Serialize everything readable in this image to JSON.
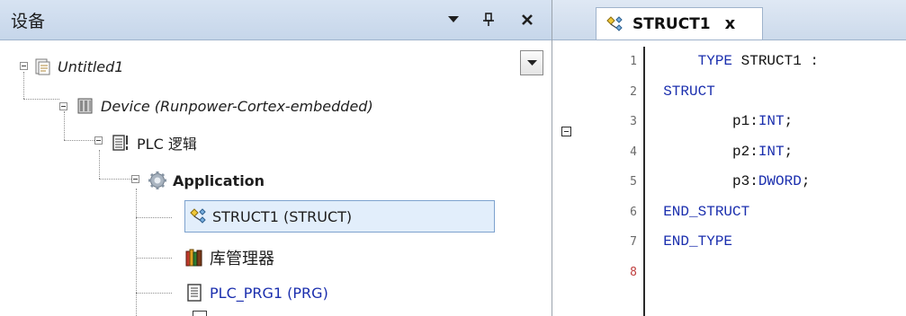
{
  "devices_panel": {
    "title": "设备",
    "pin_glyph": "ᵠ",
    "close_glyph": "✕"
  },
  "tree": {
    "nodes": [
      {
        "label": "Untitled1",
        "icon": "project-icon"
      },
      {
        "label": "Device (Runpower-Cortex-embedded)",
        "icon": "device-icon"
      },
      {
        "label": "PLC 逻辑",
        "icon": "plc-logic-icon"
      },
      {
        "label": "Application",
        "icon": "application-gear-icon"
      },
      {
        "label": "STRUCT1 (STRUCT)",
        "icon": "struct-icon",
        "selected": true
      },
      {
        "label": "库管理器",
        "icon": "library-manager-icon"
      },
      {
        "label": "PLC_PRG1 (PRG)",
        "icon": "program-icon"
      }
    ]
  },
  "editor": {
    "tab_title": "STRUCT1",
    "tab_close": "x",
    "lines": [
      {
        "no": "1",
        "indent": "    ",
        "parts": [
          [
            "kw",
            "TYPE"
          ],
          [
            "plain",
            " STRUCT1 :"
          ]
        ]
      },
      {
        "no": "2",
        "indent": "",
        "parts": [
          [
            "kw",
            "STRUCT"
          ]
        ]
      },
      {
        "no": "3",
        "indent": "        ",
        "parts": [
          [
            "plain",
            "p1:"
          ],
          [
            "kw",
            "INT"
          ],
          [
            "plain",
            ";"
          ]
        ]
      },
      {
        "no": "4",
        "indent": "        ",
        "parts": [
          [
            "plain",
            "p2:"
          ],
          [
            "kw",
            "INT"
          ],
          [
            "plain",
            ";"
          ]
        ]
      },
      {
        "no": "5",
        "indent": "        ",
        "parts": [
          [
            "plain",
            "p3:"
          ],
          [
            "kw",
            "DWORD"
          ],
          [
            "plain",
            ";"
          ]
        ]
      },
      {
        "no": "6",
        "indent": "",
        "parts": [
          [
            "kw",
            "END_STRUCT"
          ]
        ]
      },
      {
        "no": "7",
        "indent": "",
        "parts": [
          [
            "kw",
            "END_TYPE"
          ]
        ]
      },
      {
        "no": "8",
        "indent": "",
        "parts": []
      }
    ]
  },
  "colors": {
    "keyword": "#1b2fae",
    "selection_bg": "#e2eefb",
    "selection_border": "#7da2ce",
    "header_bg": "#c6d6ea"
  }
}
